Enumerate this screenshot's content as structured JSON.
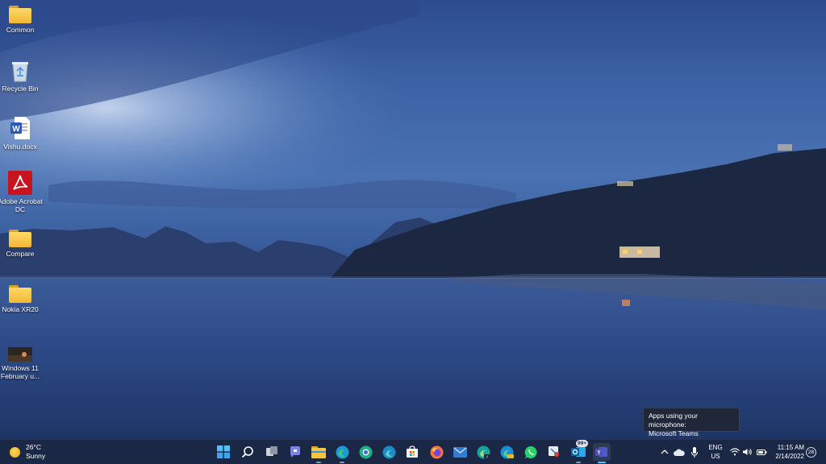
{
  "desktop": {
    "icons": [
      {
        "label": "Common",
        "icon": "folder-icon"
      },
      {
        "label": "Recycle Bin",
        "icon": "recycle-bin-icon"
      },
      {
        "label": "Vishu.docx",
        "icon": "word-document-icon"
      },
      {
        "label": "Adobe Acrobat DC",
        "icon": "adobe-acrobat-icon"
      },
      {
        "label": "Compare",
        "icon": "folder-icon"
      },
      {
        "label": "Nokia XR20",
        "icon": "folder-icon"
      },
      {
        "label": "Windows 11 February u...",
        "icon": "image-thumbnail-icon"
      }
    ]
  },
  "tooltip": {
    "line1": "Apps using your microphone:",
    "line2": "Microsoft Teams"
  },
  "taskbar": {
    "weather": {
      "temp": "26°C",
      "condition": "Sunny",
      "icon": "sun-icon"
    },
    "apps": [
      {
        "name": "start",
        "icon": "windows-start-icon"
      },
      {
        "name": "search",
        "icon": "search-icon"
      },
      {
        "name": "task-view",
        "icon": "task-view-icon"
      },
      {
        "name": "chat",
        "icon": "teams-chat-icon"
      },
      {
        "name": "file-explorer",
        "icon": "folder-icon"
      },
      {
        "name": "edge",
        "icon": "edge-icon"
      },
      {
        "name": "chrome-beta",
        "icon": "browser-icon"
      },
      {
        "name": "edge-dev",
        "icon": "edge-dev-icon"
      },
      {
        "name": "store",
        "icon": "store-icon"
      },
      {
        "name": "firefox",
        "icon": "firefox-icon"
      },
      {
        "name": "mail",
        "icon": "mail-icon"
      },
      {
        "name": "edge-beta",
        "icon": "edge-beta-icon"
      },
      {
        "name": "edge-canary",
        "icon": "edge-canary-icon"
      },
      {
        "name": "whatsapp",
        "icon": "whatsapp-icon"
      },
      {
        "name": "snipping-tool",
        "icon": "snipping-tool-icon"
      },
      {
        "name": "outlook",
        "icon": "outlook-icon",
        "badge": "99+"
      },
      {
        "name": "teams",
        "icon": "teams-icon"
      }
    ],
    "tray": {
      "language": "ENG",
      "region": "US",
      "time": "11:15 AM",
      "date": "2/14/2022",
      "notifications": "28"
    }
  },
  "colors": {
    "taskbar_bg": "#1b2845",
    "folder_yellow": "#f2b637",
    "accent": "#3b8eea"
  }
}
